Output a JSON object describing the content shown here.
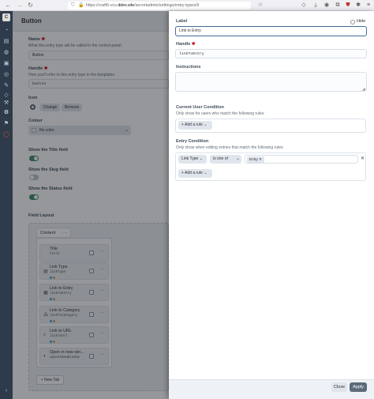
{
  "browser": {
    "url_prefix": "https://craft5-vcs.",
    "url_domain": "ddev.site",
    "url_path": "/secretadmin/settings/entry-types/9",
    "nav": [
      "←",
      "→",
      "↻"
    ]
  },
  "sidebar": {
    "logo": "C",
    "icons": [
      "dashboard-icon",
      "entries-icon",
      "globe-icon",
      "assets-icon",
      "users-icon",
      "utilities-icon",
      "graphql-icon",
      "plugin-icon",
      "settings-icon",
      "debug-icon",
      "collapse-icon"
    ]
  },
  "page": {
    "title": "Button",
    "name": {
      "label": "Name",
      "instructions": "What this entry type will be called in the control panel.",
      "value": "Button"
    },
    "handle": {
      "label": "Handle",
      "instructions": "How you'll refer to this entry type in the templates.",
      "value": "button"
    },
    "icon": {
      "label": "Icon",
      "change": "Change",
      "remove": "Remove"
    },
    "colour": {
      "label": "Colour",
      "value": "No color"
    },
    "show_title": {
      "label": "Show the Title field",
      "on": true
    },
    "show_slug": {
      "label": "Show the Slug field",
      "on": false
    },
    "show_status": {
      "label": "Show the Status field",
      "on": true
    },
    "field_layout": {
      "label": "Field Layout",
      "tab": "Content",
      "tab_menu": "···",
      "fields": [
        {
          "name": "Title",
          "handle": "title",
          "icon": "",
          "badges": false
        },
        {
          "name": "Link Type",
          "handle": "linkType",
          "icon": "▤",
          "badges": true
        },
        {
          "name": "Link to Entry",
          "handle": "linkToEntry",
          "icon": "▦",
          "badges": true
        },
        {
          "name": "Link to Category",
          "handle": "linkToCategory",
          "icon": "⁂",
          "badges": true
        },
        {
          "name": "Link to URL",
          "handle": "linkToUrl",
          "icon": "⌕",
          "badges": true
        },
        {
          "name": "Open in new win...",
          "handle": "openInNewWindow",
          "icon": "◐",
          "badges": false
        }
      ],
      "new_tab": "+ New Tab"
    }
  },
  "slideout": {
    "label": {
      "label": "Label",
      "value": "Link to Entry",
      "hide": "Hide"
    },
    "handle": {
      "label": "Handle",
      "value": "linkToEntry"
    },
    "instructions": {
      "label": "Instructions",
      "value": ""
    },
    "user_condition": {
      "label": "Current User Condition",
      "instructions": "Only show for users who match the following rules:",
      "add_rule": "+ Add a rule"
    },
    "entry_condition": {
      "label": "Entry Condition",
      "instructions": "Only show when editing entries that match the following rules:",
      "rule_field": "Link Type",
      "rule_operator": "is one of",
      "rule_value": "Entry",
      "add_rule": "+ Add a rule"
    },
    "close": "Close",
    "apply": "Apply"
  },
  "colors": {
    "accent": "#3f8c6a",
    "apply": "#5c6b7a",
    "sidebar": "#2e3b4a"
  }
}
